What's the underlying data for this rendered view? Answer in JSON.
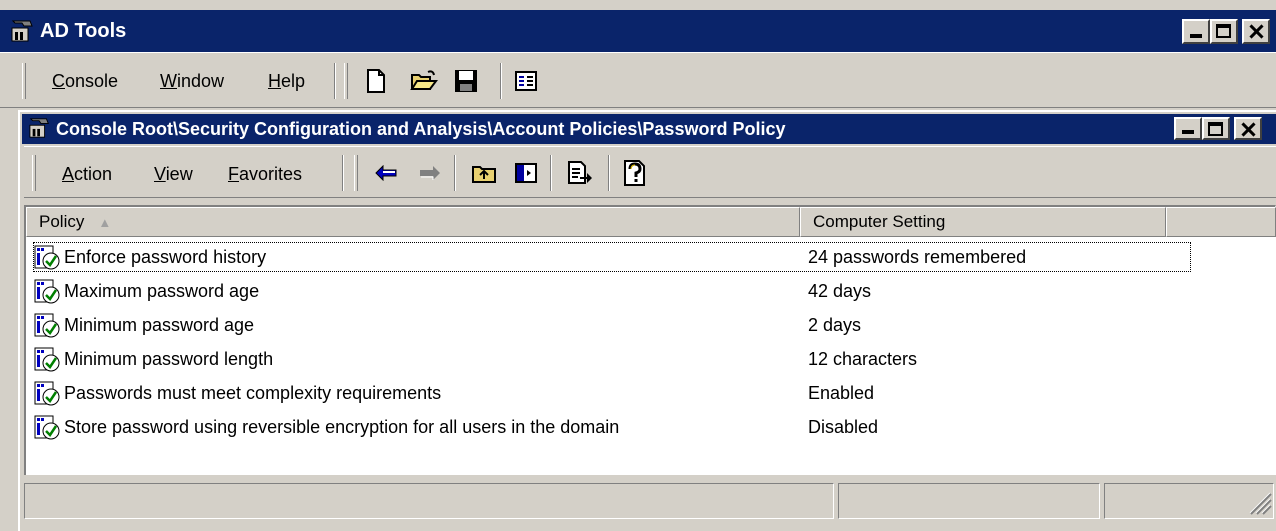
{
  "app": {
    "title": "AD Tools"
  },
  "main_menu": [
    "Console",
    "Window",
    "Help"
  ],
  "main_menu_access_keys": [
    "C",
    "W",
    "H"
  ],
  "main_toolbar_icons": [
    "new-document-icon",
    "open-folder-icon",
    "save-icon",
    "window-list-icon"
  ],
  "child_window": {
    "title": "Console Root\\Security Configuration and Analysis\\Account Policies\\Password Policy",
    "menu": [
      "Action",
      "View",
      "Favorites"
    ],
    "menu_access_keys": [
      "A",
      "V",
      "F"
    ],
    "toolbar_icons": [
      "back-arrow-icon",
      "forward-arrow-icon",
      "up-folder-icon",
      "show-hide-tree-icon",
      "export-list-icon",
      "help-icon"
    ]
  },
  "list": {
    "columns": [
      "Policy",
      "Computer Setting"
    ],
    "sort_indicator": "▲",
    "rows": [
      {
        "policy": "Enforce password history",
        "setting": "24 passwords remembered"
      },
      {
        "policy": "Maximum password age",
        "setting": "42 days"
      },
      {
        "policy": "Minimum password age",
        "setting": "2 days"
      },
      {
        "policy": "Minimum password length",
        "setting": "12 characters"
      },
      {
        "policy": "Passwords must meet complexity requirements",
        "setting": "Enabled"
      },
      {
        "policy": "Store password using reversible encryption for all users in the domain",
        "setting": "Disabled"
      }
    ]
  },
  "status_bar": {
    "panels": [
      "",
      "",
      ""
    ]
  },
  "colors": {
    "title_bar": "#0a246a",
    "face": "#d4d0c8",
    "arrow_back": "#0000c0",
    "arrow_forward": "#808080"
  }
}
